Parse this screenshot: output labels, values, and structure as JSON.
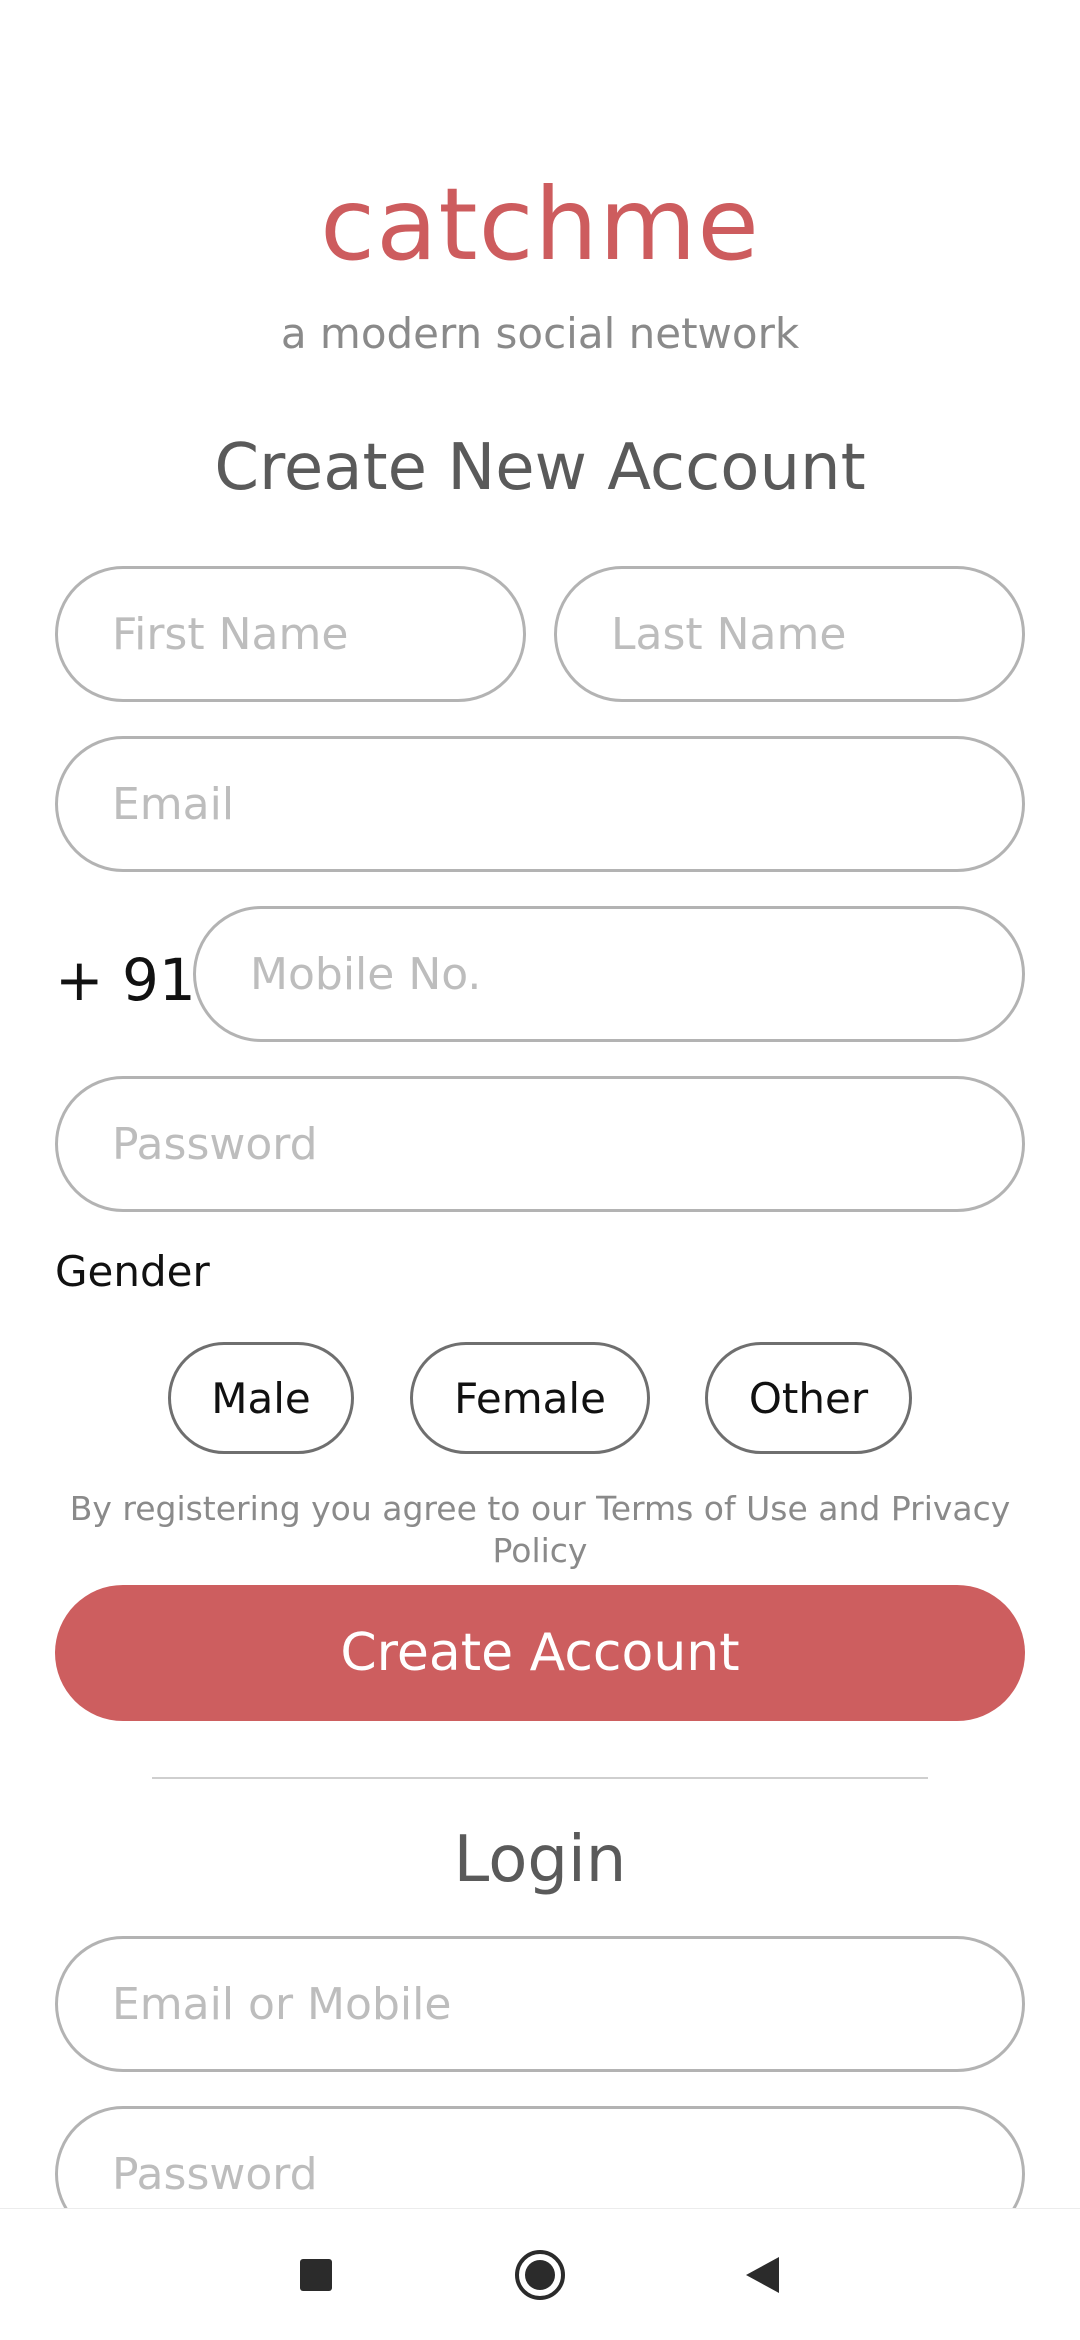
{
  "brand": {
    "name": "catchme",
    "tagline": "a modern social network"
  },
  "signup": {
    "title": "Create New Account",
    "first_name_placeholder": "First Name",
    "last_name_placeholder": "Last Name",
    "email_placeholder": "Email",
    "country_code": "+ 91",
    "mobile_placeholder": "Mobile No.",
    "password_placeholder": "Password",
    "gender_label": "Gender",
    "gender_options": [
      "Male",
      "Female",
      "Other"
    ],
    "terms_text": "By registering you agree to our Terms of Use and Privacy Policy",
    "submit_label": "Create Account"
  },
  "login": {
    "title": "Login",
    "identifier_placeholder": "Email or Mobile",
    "password_placeholder": "Password"
  },
  "nav": {
    "recents": "square-icon",
    "home": "circle-icon",
    "back": "triangle-back-icon"
  },
  "colors": {
    "accent": "#cd5e5f",
    "field_border": "#b3b3b3",
    "placeholder": "#bdbdbd"
  }
}
